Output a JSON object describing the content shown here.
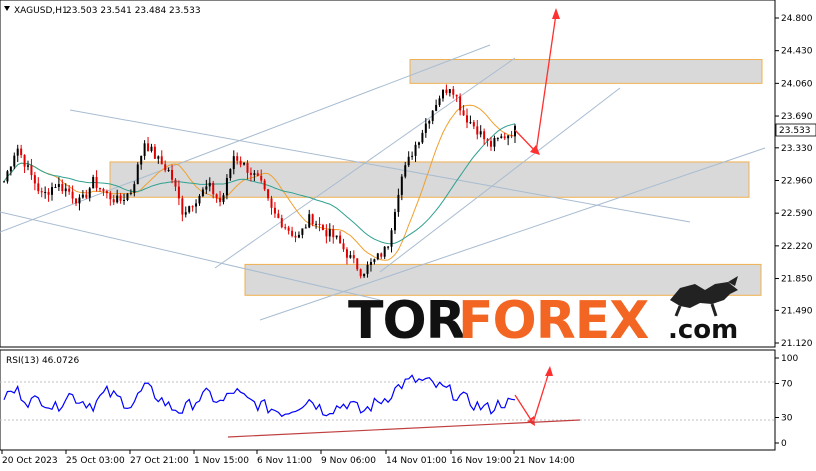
{
  "header": {
    "symbol_label": "XAGUSD,H1",
    "ohlc_label": "23.503 23.541 23.484 23.533"
  },
  "rsi_header": {
    "label": "RSI(13) 46.0726"
  },
  "logo": {
    "text_dark": "TOR",
    "text_orange": "FOREX",
    "text_suffix": ".com"
  },
  "colors": {
    "bull_candle": "#000000",
    "bear_candle": "#e00000",
    "ma_fast": "#f0a030",
    "ma_slow": "#30a090",
    "rsi_line": "#0000ff",
    "zone_fill": "#d9d9d9",
    "zone_border": "#f0b050",
    "channel_line": "#a0b8d0",
    "arrow": "#ff3030",
    "support_line": "#c04040",
    "logo_orange": "#f26522",
    "logo_dark": "#111111"
  },
  "chart_data": [
    {
      "type": "candlestick",
      "symbol": "XAGUSD",
      "timeframe": "H1",
      "ylim": [
        21.12,
        24.98
      ],
      "y_ticks": [
        "24.800",
        "24.430",
        "24.060",
        "23.690",
        "23.330",
        "22.960",
        "22.590",
        "22.220",
        "21.850",
        "21.490",
        "21.120"
      ],
      "x_ticks": [
        "20 Oct 2023",
        "25 Oct 03:00",
        "27 Oct 21:00",
        "1 Nov 15:00",
        "6 Nov 11:00",
        "9 Nov 06:00",
        "14 Nov 01:00",
        "16 Nov 19:00",
        "21 Nov 14:00"
      ],
      "current_price": "23.533",
      "series_close": [
        22.95,
        23.35,
        23.05,
        22.78,
        22.92,
        22.85,
        22.7,
        22.95,
        22.8,
        22.72,
        22.85,
        23.4,
        23.2,
        23.05,
        22.6,
        22.75,
        22.9,
        22.7,
        23.25,
        23.1,
        22.95,
        22.6,
        22.45,
        22.3,
        22.55,
        22.4,
        22.3,
        22.1,
        21.92,
        22.05,
        22.2,
        22.95,
        23.3,
        23.6,
        23.9,
        24.05,
        23.7,
        23.55,
        23.35,
        23.45,
        23.533
      ],
      "resistance_zone": [
        24.06,
        24.33
      ],
      "middle_zone": [
        22.77,
        23.17
      ],
      "support_zone": [
        21.66,
        22.01
      ],
      "forecast": [
        "23.330",
        "24.800"
      ]
    },
    {
      "type": "line",
      "indicator": "RSI(13)",
      "last_value": 46.0726,
      "ylim": [
        0,
        100
      ],
      "y_ticks": [
        "100",
        "70",
        "30",
        "0"
      ],
      "values": [
        55,
        62,
        48,
        52,
        40,
        58,
        50,
        45,
        60,
        52,
        44,
        66,
        55,
        42,
        38,
        50,
        58,
        46,
        62,
        50,
        45,
        40,
        36,
        44,
        52,
        38,
        42,
        48,
        36,
        46,
        54,
        68,
        74,
        72,
        66,
        60,
        52,
        44,
        40,
        48,
        46
      ]
    }
  ]
}
